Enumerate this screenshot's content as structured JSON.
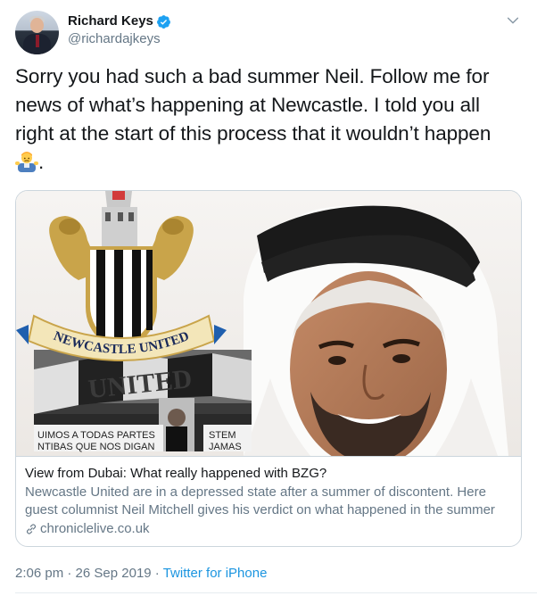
{
  "author": {
    "display_name": "Richard Keys",
    "handle": "@richardajkeys",
    "verified": true
  },
  "tweet": {
    "text": "Sorry you had such a bad summer Neil. Follow me for news of what’s happening at Newcastle. I told you all right at the start of this process that it wouldn’t happen",
    "trailing_emoji": "man-shrugging-emoji",
    "trailing_punctuation": "."
  },
  "card": {
    "title": "View from Dubai: What really happened with BZG?",
    "description": "Newcastle United are in a depressed state after a summer of discontent. Here guest columnist Neil Mitchell gives his verdict on what happened in the summer",
    "domain": "chroniclelive.co.uk",
    "image": {
      "crest_banner": "NEWCASTLE UNITED",
      "banner_left_1": "UIMOS A TODAS PARTES",
      "banner_left_2": "NTIBAS QUE NOS DIGAN",
      "banner_right_1": "STEM",
      "banner_right_2": "JAMAS"
    }
  },
  "footer": {
    "time": "2:06 pm",
    "separator": "·",
    "date": "26 Sep 2019",
    "source": "Twitter for iPhone"
  },
  "colors": {
    "text": "#14171a",
    "secondary": "#657786",
    "link": "#1b95e0",
    "verified": "#1da1f2",
    "border": "#ccd6dd"
  }
}
